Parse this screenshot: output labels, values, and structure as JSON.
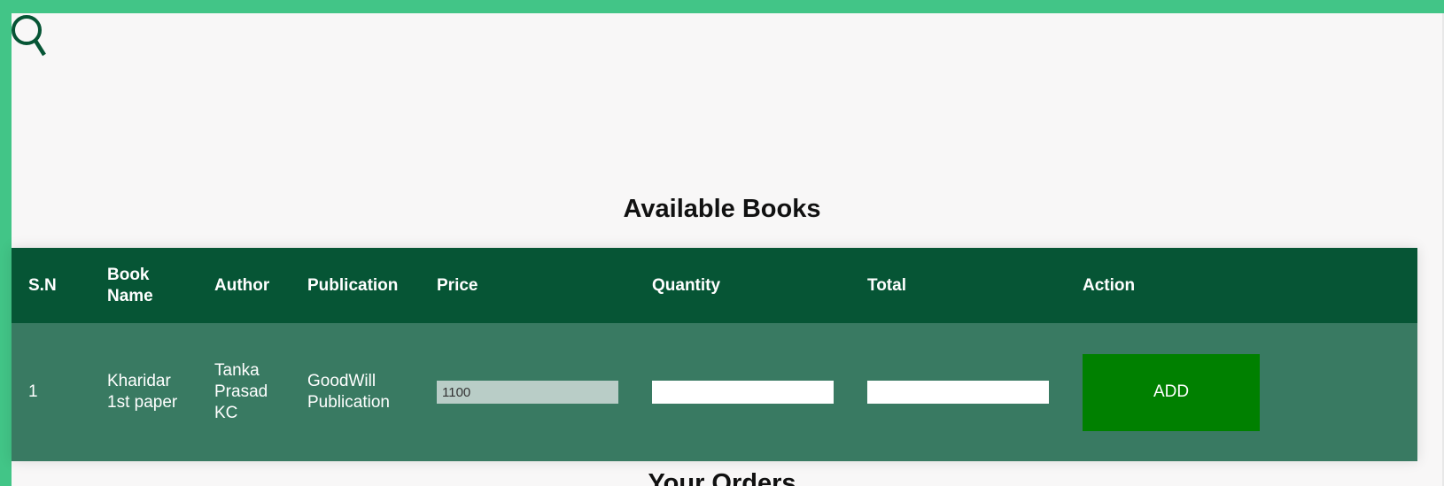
{
  "search": {
    "icon": "search-icon",
    "color": "#065535"
  },
  "header": {
    "title": "Available Books"
  },
  "table": {
    "columns": [
      "S.N",
      "Book Name",
      "Author",
      "Publication",
      "Price",
      "Quantity",
      "Total",
      "Action"
    ],
    "rows": [
      {
        "sn": "1",
        "book_name": "Kharidar 1st paper",
        "author": "Tanka Prasad KC",
        "publication": "GoodWill Publication",
        "price": "1100",
        "quantity": "",
        "total": "",
        "action_label": "ADD"
      }
    ]
  },
  "orders": {
    "title": "Your Orders"
  },
  "colors": {
    "accent": "#42c587",
    "header_bg": "#065535",
    "row_bg": "#397a62",
    "button_bg": "#008000"
  }
}
